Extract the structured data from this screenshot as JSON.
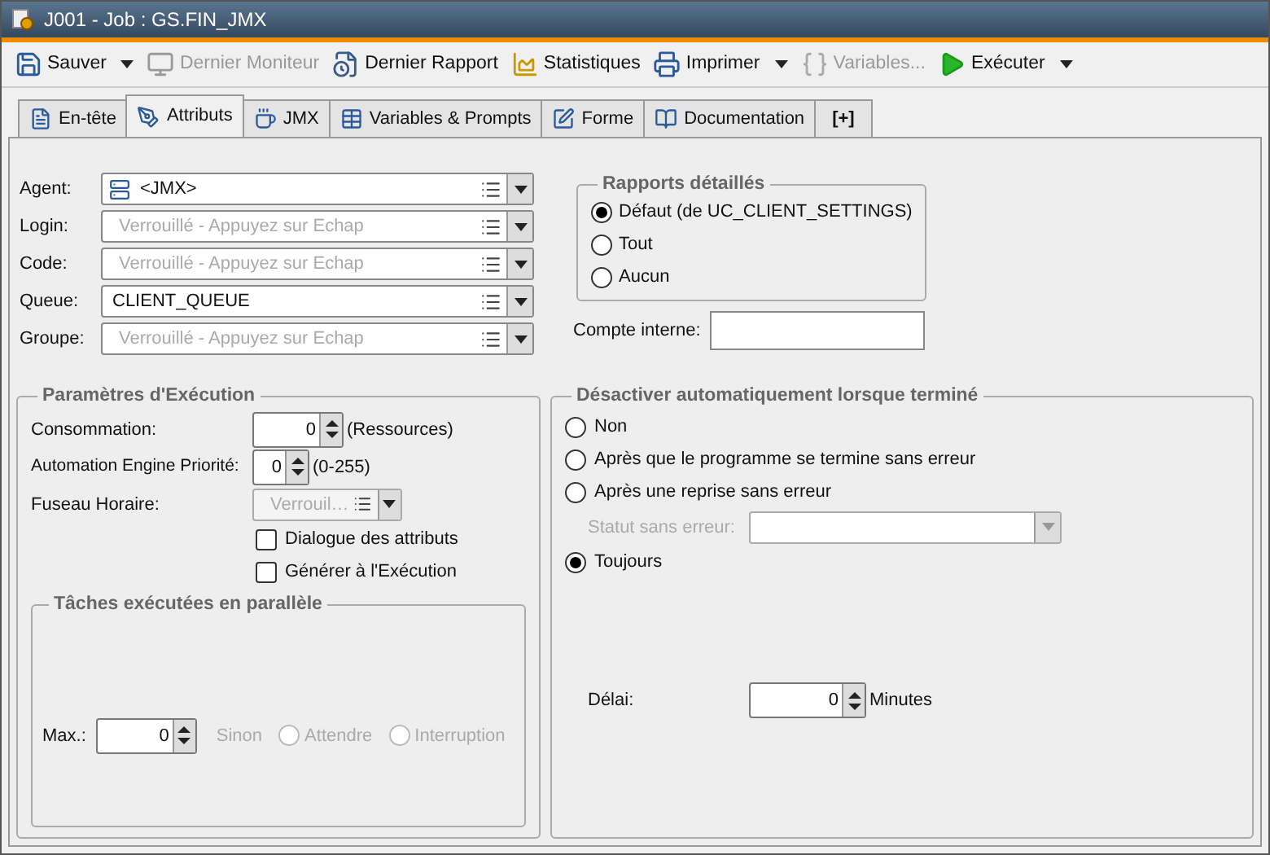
{
  "window": {
    "title": "J001 - Job : GS.FIN_JMX"
  },
  "toolbar": [
    {
      "label": "Sauver",
      "disabled": false,
      "dropdown": true
    },
    {
      "label": "Dernier Moniteur",
      "disabled": true,
      "dropdown": false
    },
    {
      "label": "Dernier Rapport",
      "disabled": false,
      "dropdown": false
    },
    {
      "label": "Statistiques",
      "disabled": false,
      "dropdown": false
    },
    {
      "label": "Imprimer",
      "disabled": false,
      "dropdown": true
    },
    {
      "label": "Variables...",
      "disabled": true,
      "dropdown": false
    },
    {
      "label": "Exécuter",
      "disabled": false,
      "dropdown": true
    }
  ],
  "tabs": [
    {
      "label": "En-tête",
      "selected": false
    },
    {
      "label": "Attributs",
      "selected": true
    },
    {
      "label": "JMX",
      "selected": false
    },
    {
      "label": "Variables & Prompts",
      "selected": false
    },
    {
      "label": "Forme",
      "selected": false
    },
    {
      "label": "Documentation",
      "selected": false
    },
    {
      "label": "[+]",
      "selected": false
    }
  ],
  "fields": [
    {
      "label": "Agent:",
      "value": "<JMX>",
      "kind": "agent"
    },
    {
      "label": "Login:",
      "placeholder": "Verrouillé - Appuyez sur Echap",
      "kind": "plain"
    },
    {
      "label": "Code:",
      "placeholder": "Verrouillé - Appuyez sur Echap",
      "kind": "plain"
    },
    {
      "label": "Queue:",
      "value": "CLIENT_QUEUE",
      "kind": "plain"
    },
    {
      "label": "Groupe:",
      "placeholder": "Verrouillé - Appuyez sur Echap",
      "kind": "plain"
    }
  ],
  "detailed_reports": {
    "title": "Rapports détaillés",
    "options": [
      {
        "label": "Défaut (de UC_CLIENT_SETTINGS)",
        "selected": true
      },
      {
        "label": "Tout",
        "selected": false
      },
      {
        "label": "Aucun",
        "selected": false
      }
    ]
  },
  "internal_account": {
    "label": "Compte interne:"
  },
  "execution": {
    "title": "Paramètres d'Exécution",
    "consumption": {
      "label": "Consommation:",
      "value": "0",
      "unit": "(Ressources)"
    },
    "priority": {
      "label": "Automation Engine Priorité:",
      "value": "0",
      "unit": "(0-255)"
    },
    "timezone": {
      "label": "Fuseau Horaire:",
      "placeholder": "Verrouil…",
      "disabled": true
    },
    "checkboxes": [
      {
        "label": "Dialogue des attributs",
        "checked": false
      },
      {
        "label": "Générer à l'Exécution",
        "checked": false
      }
    ],
    "parallel": {
      "title": "Tâches exécutées en parallèle",
      "max": {
        "label": "Max.:",
        "value": "0"
      },
      "else_label": "Sinon",
      "disabled": true,
      "options": [
        {
          "label": "Attendre",
          "selected": false
        },
        {
          "label": "Interruption",
          "selected": false
        }
      ]
    }
  },
  "auto_deactivate": {
    "title": "Désactiver automatiquement lorsque terminé",
    "items": [
      {
        "kind": "radio",
        "label": "Non",
        "selected": false
      },
      {
        "kind": "radio",
        "label": "Après que le programme se termine sans erreur",
        "selected": false
      },
      {
        "kind": "radio",
        "label": "Après une reprise sans erreur",
        "selected": false
      },
      {
        "kind": "select",
        "label": "Statut sans erreur:",
        "disabled": true
      },
      {
        "kind": "radio",
        "label": "Toujours",
        "selected": true
      }
    ],
    "delay": {
      "label": "Délai:",
      "value": "0",
      "unit": "Minutes"
    }
  }
}
